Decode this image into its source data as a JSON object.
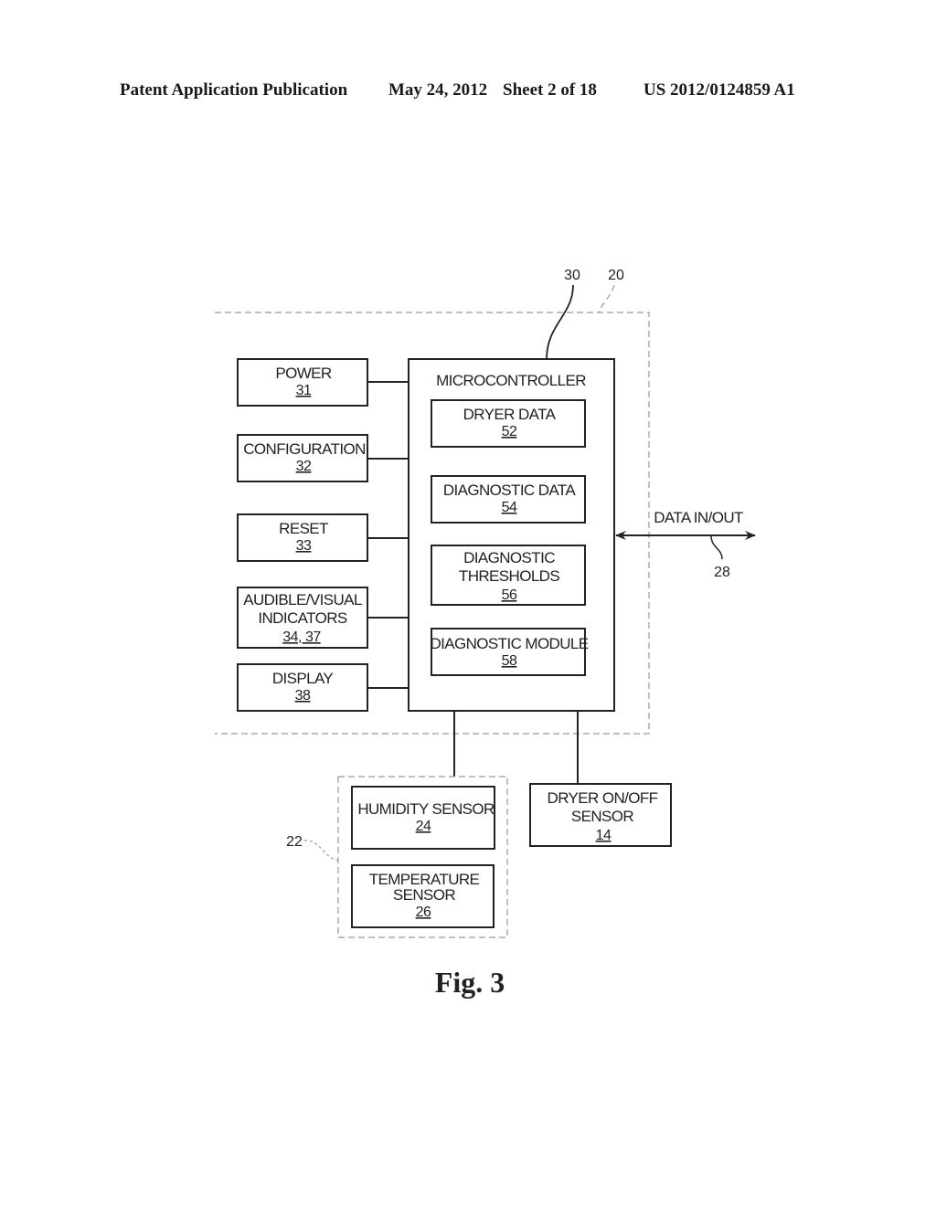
{
  "header": {
    "publication": "Patent Application Publication",
    "date": "May 24, 2012",
    "sheet": "Sheet 2 of 18",
    "number": "US 2012/0124859 A1"
  },
  "figure": {
    "caption": "Fig. 3",
    "callouts": {
      "device": "20",
      "microcontroller": "30",
      "sensor_group": "22",
      "data_line": "28"
    },
    "data_io_label": "DATA IN/OUT",
    "microcontroller": {
      "title": "MICROCONTROLLER",
      "modules": [
        {
          "lines": [
            "DRYER DATA"
          ],
          "ref": "52"
        },
        {
          "lines": [
            "DIAGNOSTIC DATA"
          ],
          "ref": "54"
        },
        {
          "lines": [
            "DIAGNOSTIC",
            "THRESHOLDS"
          ],
          "ref": "56"
        },
        {
          "lines": [
            "DIAGNOSTIC MODULE"
          ],
          "ref": "58"
        }
      ]
    },
    "left_blocks": [
      {
        "lines": [
          "POWER"
        ],
        "ref": "31"
      },
      {
        "lines": [
          "CONFIGURATION"
        ],
        "ref": "32"
      },
      {
        "lines": [
          "RESET"
        ],
        "ref": "33"
      },
      {
        "lines": [
          "AUDIBLE/VISUAL",
          "INDICATORS"
        ],
        "ref": "34, 37"
      },
      {
        "lines": [
          "DISPLAY"
        ],
        "ref": "38"
      }
    ],
    "sensors": [
      {
        "lines": [
          "HUMIDITY SENSOR"
        ],
        "ref": "24"
      },
      {
        "lines": [
          "TEMPERATURE",
          "SENSOR"
        ],
        "ref": "26"
      }
    ],
    "external_sensor": {
      "lines": [
        "DRYER ON/OFF",
        "SENSOR"
      ],
      "ref": "14"
    }
  }
}
